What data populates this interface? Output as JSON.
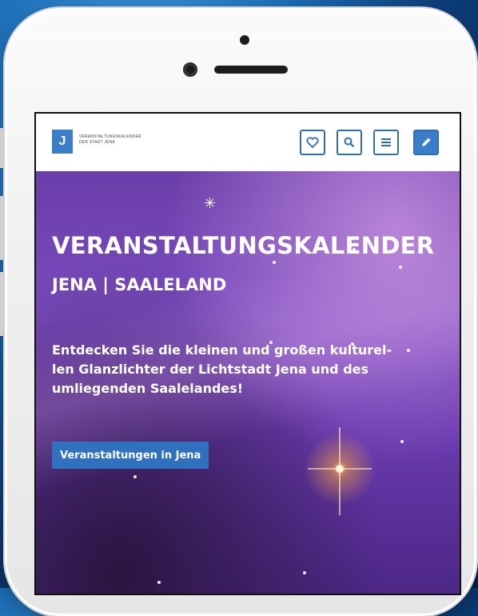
{
  "header": {
    "logo_letter": "J",
    "logo_text_line1": "VERANSTALTUNGSKALENDER",
    "logo_text_line2": "DER STADT JENA",
    "buttons": [
      {
        "icon": "heart-icon"
      },
      {
        "icon": "search-icon"
      },
      {
        "icon": "menu-icon"
      },
      {
        "icon": "pencil-icon"
      }
    ]
  },
  "hero": {
    "title": "VERANSTALTUNGSKALENDER",
    "subtitle": "JENA | SAALELAND",
    "text_line1": "Entdecken Sie die kleinen und großen kulturel-",
    "text_line2": "len Glanzlichter der Lichtstadt Jena und des",
    "text_line3": "umliegenden Saalelandes!",
    "cta_label": "Veranstaltungen in Jena"
  },
  "colors": {
    "accent": "#3a7dc8",
    "hero_purple": "#6b3bb0",
    "background_blue": "#1c6fb8"
  }
}
